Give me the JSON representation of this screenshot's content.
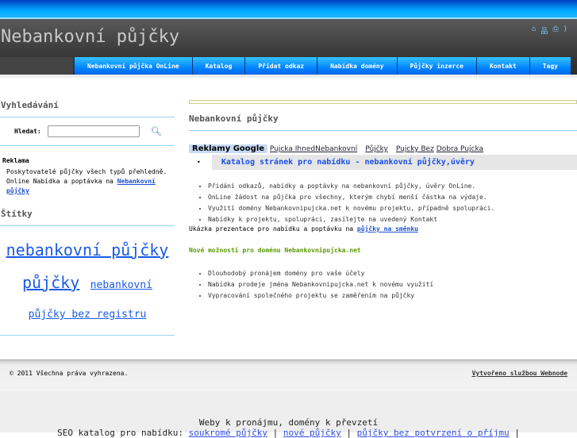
{
  "header": {
    "title": "Nebankovní půjčky"
  },
  "nav": [
    "Nebankovní půjčka OnLine",
    "Katalog",
    "Přidat odkaz",
    "Nabídka domény",
    "Půjčky inzerce",
    "Kontakt",
    "Tagy"
  ],
  "sidebar": {
    "search_heading": "Vyhledávání",
    "search_label": "Hledat:",
    "ad_title": "Reklama",
    "ad_text": "Poskytovatelé půjčky všech typů přehledně. Online Nabídka a poptávka na ",
    "ad_link": "Nebankovní půjčky",
    "tags_heading": "Štítky",
    "tags": [
      "nebankovní půjčky",
      "půjčky",
      "nebankovní",
      "půjčky bez registru"
    ]
  },
  "main": {
    "heading": "Nebankovní půjčky",
    "ads_label": "Reklamy Google",
    "ad_links": [
      "Pujcka IhnedNebankovní",
      "Půjčky",
      "Pujcky Bez",
      "Dobra Pujcka"
    ],
    "katalog": "Katalog stránek pro nabídku - nebankovní půjčky,úvěry",
    "bullets1": [
      "Přidání odkazů, nabídky a poptávky na nebankovní půjčky, úvěry OnLine.",
      "OnLine žádost na půjčka pro všechny, kterým chybí menší částka na výdaje.",
      "Využití domény Nebankovnipujcka.net k novému projektu, případně spolupráci.",
      "Nabídky k projektu, spolupráci, zasílejte na uvedený Kontakt"
    ],
    "demo_text": "Ukázka prezentace pro nabídku a poptávku na ",
    "demo_link": "půjčky na směnku",
    "green": "Nové možnosti pro doménu Nebankovnipujcka.net",
    "bullets2": [
      "Dlouhodobý pronájem domény pro vaše účely",
      "Nabídka prodeje jména Nebankovnipujcka.net k novému využití",
      "Vypracování společného projektu se zaměřením na půjčky"
    ]
  },
  "footer": {
    "copyright": "© 2011 Všechna práva vyhrazena.",
    "webnode": "Vytvořeno službou Webnode"
  },
  "bottom": {
    "line1": "Weby k pronájmu, domény k převzetí",
    "seo": "SEO katalog pro nabídku: ",
    "links": [
      "soukromé půjčky",
      "nové půjčky",
      "půjčky bez potvrzení o příjmu"
    ]
  }
}
